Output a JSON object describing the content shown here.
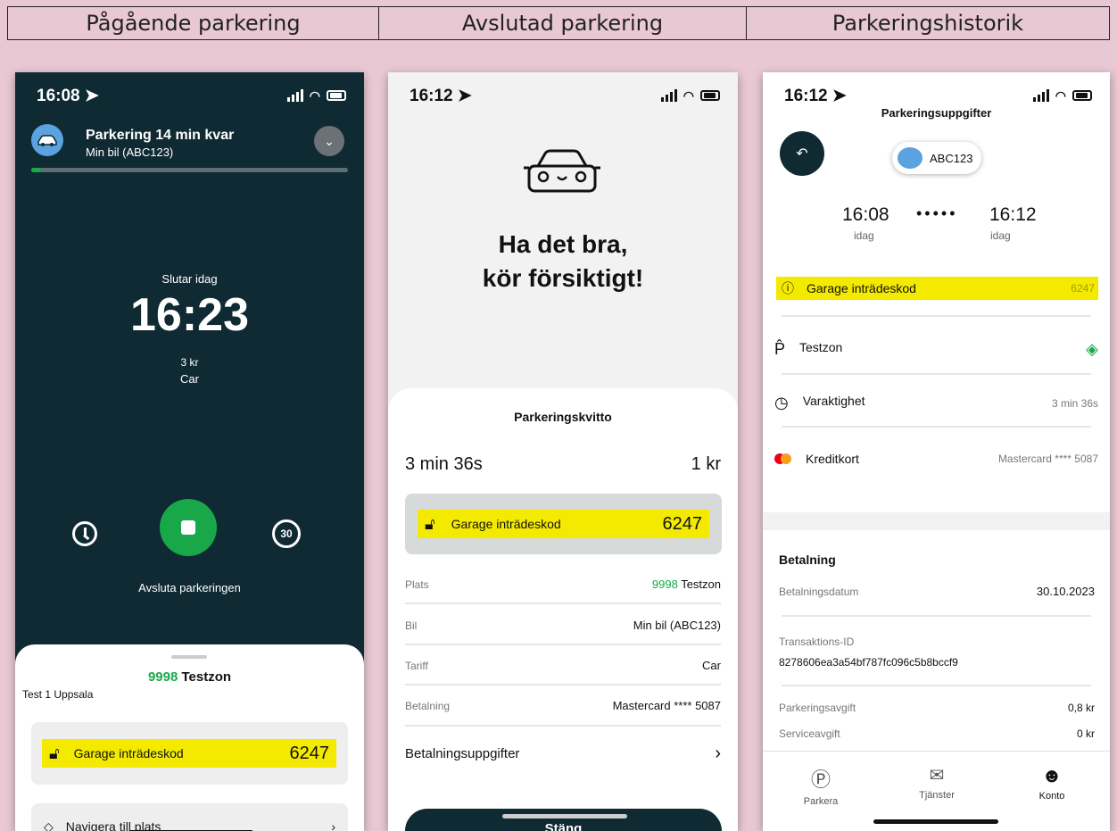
{
  "headers": [
    "Pågående parkering",
    "Avslutad parkering",
    "Parkeringshistorik"
  ],
  "screen1": {
    "time": "16:08",
    "title": "Parkering 14 min kvar",
    "subtitle": "Min bil (ABC123)",
    "ends_label": "Slutar idag",
    "end_time": "16:23",
    "price": "3 kr",
    "tariff": "Car",
    "stop_label": "Avsluta parkeringen",
    "extend_label": "30",
    "zone_code": "9998",
    "zone_name": "Testzon",
    "location": "Test 1 Uppsala",
    "code_label": "Garage inträdeskod",
    "code_value": "6247",
    "nav_label": "Navigera till plats"
  },
  "screen2": {
    "time": "16:12",
    "farewell_line1": "Ha det bra,",
    "farewell_line2": "kör försiktigt!",
    "receipt_title": "Parkeringskvitto",
    "duration": "3 min 36s",
    "cost": "1 kr",
    "code_label": "Garage inträdeskod",
    "code_value": "6247",
    "rows": [
      {
        "label": "Plats",
        "code": "9998",
        "value": "Testzon"
      },
      {
        "label": "Bil",
        "value": "Min bil (ABC123)"
      },
      {
        "label": "Tariff",
        "value": "Car"
      },
      {
        "label": "Betalning",
        "value": "Mastercard **** 5087"
      }
    ],
    "payment_details": "Betalningsuppgifter",
    "close_label": "Stäng"
  },
  "screen3": {
    "time": "16:12",
    "title": "Parkeringsuppgifter",
    "plate": "ABC123",
    "start_time": "16:08",
    "start_day": "idag",
    "end_time": "16:12",
    "end_day": "idag",
    "code_label": "Garage inträdeskod",
    "code_value": "6247",
    "zone": "Testzon",
    "duration_label": "Varaktighet",
    "duration_value": "3 min 36s",
    "card_label": "Kreditkort",
    "card_value": "Mastercard **** 5087",
    "payment_title": "Betalning",
    "paydate_label": "Betalningsdatum",
    "paydate_value": "30.10.2023",
    "txid_label": "Transaktions-ID",
    "txid_value": "8278606ea3a54bf787fc096c5b8bccf9",
    "fee_label": "Parkeringsavgift",
    "fee_value": "0,8 kr",
    "service_label": "Serviceavgift",
    "service_value": "0 kr",
    "tabs": [
      "Parkera",
      "Tjänster",
      "Konto"
    ]
  },
  "colors": {
    "dark": "#0f2a33",
    "green": "#18a84a",
    "highlight": "#f3ea00",
    "background": "#e8c9d3"
  }
}
